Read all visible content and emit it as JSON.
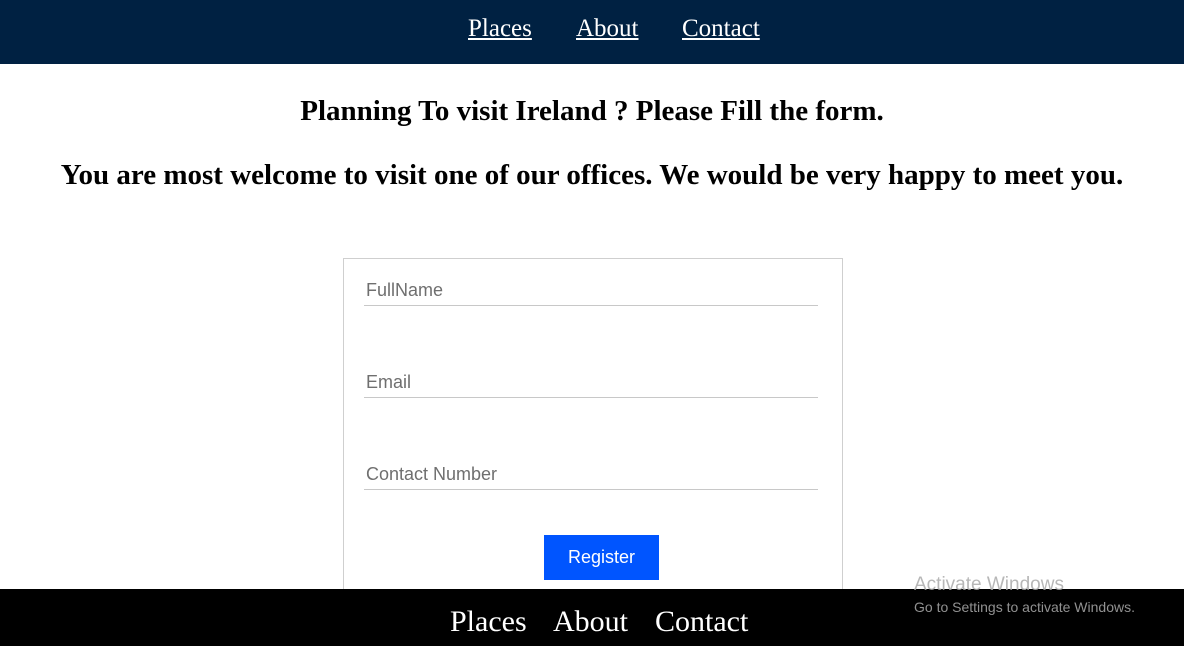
{
  "top_nav": {
    "items": [
      {
        "label": "Places"
      },
      {
        "label": "About"
      },
      {
        "label": "Contact"
      }
    ]
  },
  "headings": {
    "primary": "Planning To visit Ireland ? Please Fill the form.",
    "secondary": "You are most welcome to visit one of our offices. We would be very happy to meet you."
  },
  "form": {
    "fullname_placeholder": "FullName",
    "email_placeholder": "Email",
    "contact_placeholder": "Contact Number",
    "register_label": "Register"
  },
  "footer_nav": {
    "items": [
      {
        "label": "Places"
      },
      {
        "label": "About"
      },
      {
        "label": "Contact"
      }
    ]
  },
  "watermark": {
    "title": "Activate Windows",
    "subtitle": "Go to Settings to activate Windows."
  },
  "colors": {
    "nav_background": "#002142",
    "footer_background": "#000000",
    "button_background": "#0055ff"
  }
}
